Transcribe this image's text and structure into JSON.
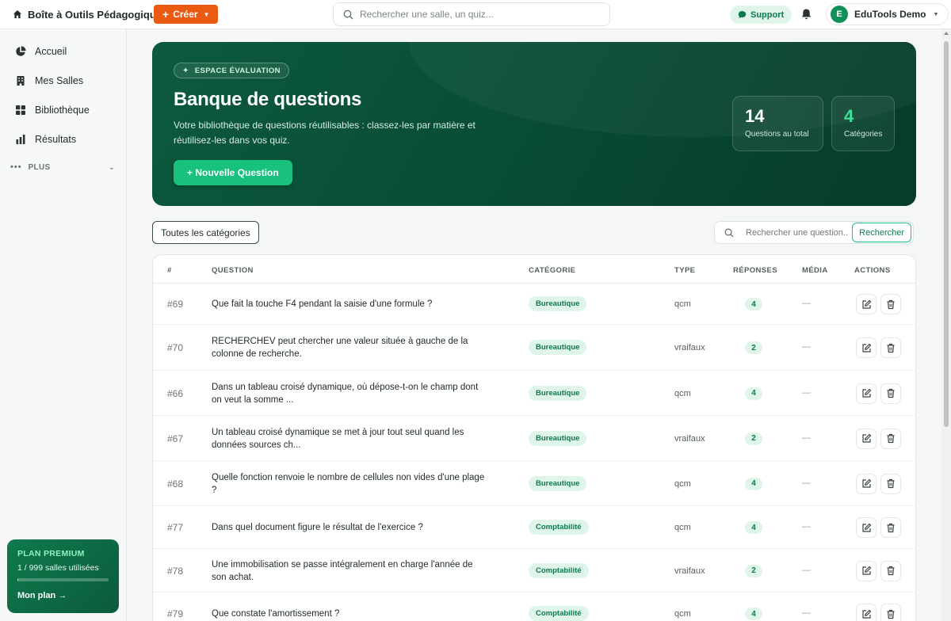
{
  "topbar": {
    "brand": "Boîte à Outils Pédagogique",
    "create_label": "Créer",
    "search_placeholder": "Rechercher une salle, un quiz...",
    "support_label": "Support",
    "user_initial": "E",
    "user_name": "EduTools Demo"
  },
  "sidebar": {
    "items": [
      {
        "label": "Accueil",
        "icon": "pie-chart-icon"
      },
      {
        "label": "Mes Salles",
        "icon": "building-icon"
      },
      {
        "label": "Bibliothèque",
        "icon": "grid-icon"
      },
      {
        "label": "Résultats",
        "icon": "bar-chart-icon"
      }
    ],
    "more_label": "PLUS",
    "plan": {
      "title": "PLAN PREMIUM",
      "usage": "1 / 999 salles utilisées",
      "usage_fraction": 0.001,
      "link": "Mon plan →"
    }
  },
  "hero": {
    "badge": "ESPACE ÉVALUATION",
    "title": "Banque de questions",
    "description": "Votre bibliothèque de questions réutilisables : classez-les par matière et réutilisez-les dans vos quiz.",
    "button": "+ Nouvelle Question",
    "stats": [
      {
        "value": "14",
        "label": "Questions au total"
      },
      {
        "value": "4",
        "label": "Catégories"
      }
    ]
  },
  "filters": {
    "category_label": "Toutes les catégories",
    "search_placeholder": "Rechercher une question...",
    "search_button": "Rechercher"
  },
  "table": {
    "headers": [
      "#",
      "QUESTION",
      "CATÉGORIE",
      "TYPE",
      "RÉPONSES",
      "MÉDIA",
      "ACTIONS"
    ],
    "rows": [
      {
        "id": "#69",
        "question": "Que fait la touche F4 pendant la saisie d'une formule ?",
        "category": "Bureautique",
        "type": "qcm",
        "answers": "4",
        "media": "—"
      },
      {
        "id": "#70",
        "question": "RECHERCHEV peut chercher une valeur située à gauche de la colonne de recherche.",
        "category": "Bureautique",
        "type": "vraifaux",
        "answers": "2",
        "media": "—"
      },
      {
        "id": "#66",
        "question": "Dans un tableau croisé dynamique, où dépose-t-on le champ dont on veut la somme ...",
        "category": "Bureautique",
        "type": "qcm",
        "answers": "4",
        "media": "—"
      },
      {
        "id": "#67",
        "question": "Un tableau croisé dynamique se met à jour tout seul quand les données sources ch...",
        "category": "Bureautique",
        "type": "vraifaux",
        "answers": "2",
        "media": "—"
      },
      {
        "id": "#68",
        "question": "Quelle fonction renvoie le nombre de cellules non vides d'une plage ?",
        "category": "Bureautique",
        "type": "qcm",
        "answers": "4",
        "media": "—"
      },
      {
        "id": "#77",
        "question": "Dans quel document figure le résultat de l'exercice ?",
        "category": "Comptabilité",
        "type": "qcm",
        "answers": "4",
        "media": "—"
      },
      {
        "id": "#78",
        "question": "Une immobilisation se passe intégralement en charge l'année de son achat.",
        "category": "Comptabilité",
        "type": "vraifaux",
        "answers": "2",
        "media": "—"
      },
      {
        "id": "#79",
        "question": "Que constate l'amortissement ?",
        "category": "Comptabilité",
        "type": "qcm",
        "answers": "4",
        "media": "—"
      }
    ]
  },
  "colors": {
    "accent": "#18c27e",
    "create": "#ea5a12",
    "hero": "#0c5a3e",
    "badge_bg": "#dff5ea",
    "badge_text": "#0b7a4b"
  }
}
